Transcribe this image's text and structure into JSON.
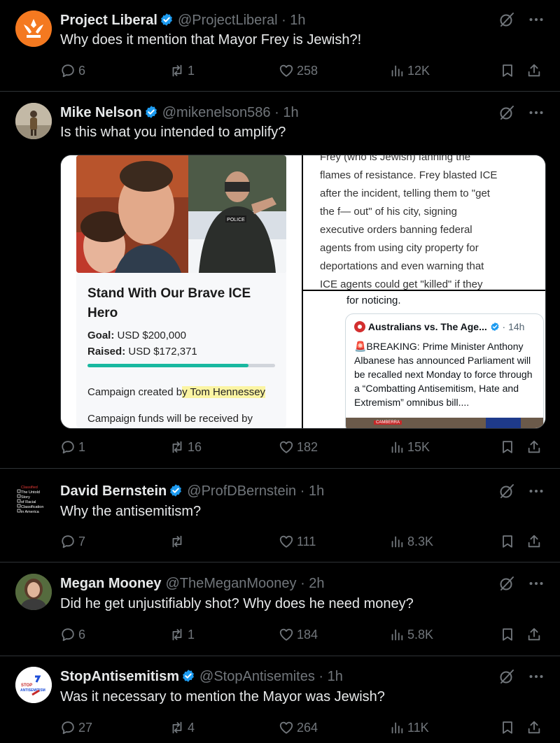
{
  "colors": {
    "bg": "#000000",
    "text": "#e7e9ea",
    "muted": "#71767b",
    "verified": "#1d9bf0",
    "divider": "#2f3336"
  },
  "tweets": [
    {
      "name": "Project Liberal",
      "handle": "@ProjectLiberal",
      "time": "· 1h",
      "text": "Why does it mention that Mayor Frey is Jewish?!",
      "replies": "6",
      "reposts": "1",
      "likes": "258",
      "views": "12K"
    },
    {
      "name": "Mike Nelson",
      "handle": "@mikenelson586",
      "time": "· 1h",
      "text": "Is this what you intended to amplify?",
      "replies": "1",
      "reposts": "16",
      "likes": "182",
      "views": "15K"
    },
    {
      "name": "David Bernstein",
      "handle": "@ProfDBernstein",
      "time": "· 1h",
      "text": "Why the antisemitism?",
      "replies": "7",
      "reposts": "",
      "likes": "111",
      "views": "8.3K"
    },
    {
      "name": "Megan Mooney",
      "handle": "@TheMeganMooney",
      "time": "· 2h",
      "text": "Did he get unjustifiably shot? Why does he need money?",
      "replies": "6",
      "reposts": "1",
      "likes": "184",
      "views": "5.8K"
    },
    {
      "name": "StopAntisemitism",
      "handle": "@StopAntisemites",
      "time": "· 1h",
      "text": "Was it necessary to mention the Mayor was Jewish?",
      "replies": "27",
      "reposts": "4",
      "likes": "264",
      "views": "11K"
    }
  ],
  "campaign": {
    "title": "Stand With Our Brave ICE Hero",
    "goal_label": "Goal:",
    "goal_value": "USD $200,000",
    "raised_label": "Raised:",
    "raised_value": "USD $172,371",
    "created_prefix": "Campaign created b",
    "created_highlight": "y Tom Hennessey",
    "funds": "Campaign funds will be received by",
    "progress": 0.86,
    "police_text": "POLICE"
  },
  "article": {
    "lines": [
      "Frey (who is Jewish) fanning the",
      "flames of resistance. Frey blasted ICE",
      "after the incident, telling them to \"get",
      "the f— out\" of his city, signing",
      "executive orders banning federal",
      "agents from using city property for",
      "deportations and even warning that",
      "ICE agents could get \"killed\" if they"
    ]
  },
  "quote": {
    "prefix": "for noticing.",
    "name": "Australians vs. The Age...",
    "time": "· 14h",
    "text": "🚨BREAKING: Prime Minister Anthony Albanese has announced Parliament will be recalled next Monday to force through a “Combatting Antisemitism, Hate and Extremism” omnibus bill....",
    "thumb_text": "CAMBERRA"
  },
  "avatar_text": {
    "bernstein": [
      "Classified",
      "The Untold",
      "Story",
      "of Racial",
      "Classification",
      "in America"
    ],
    "stop": [
      "STOP",
      "ANTISEMITISM"
    ]
  },
  "icons": [
    "grok-icon",
    "more-icon",
    "reply-icon",
    "repost-icon",
    "like-icon",
    "views-icon",
    "bookmark-icon",
    "share-icon",
    "verified-badge-icon"
  ]
}
